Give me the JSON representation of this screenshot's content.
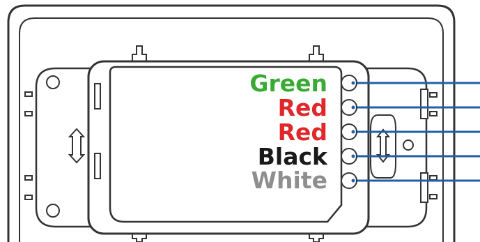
{
  "wiring": {
    "terminals": [
      {
        "label": "Green",
        "color": "#3aaa35"
      },
      {
        "label": "Red",
        "color": "#e0282b"
      },
      {
        "label": "Red",
        "color": "#e0282b"
      },
      {
        "label": "Black",
        "color": "#1a1a1a"
      },
      {
        "label": "White",
        "color": "#8e8e8e"
      }
    ],
    "wire_color": "#1f5fa8",
    "outline_color": "#333333"
  }
}
